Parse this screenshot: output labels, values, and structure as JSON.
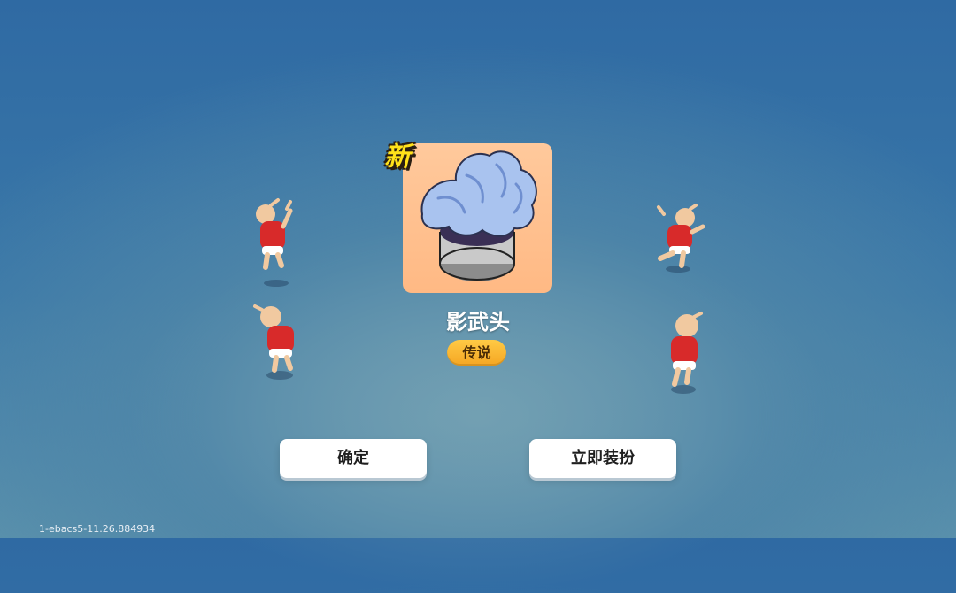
{
  "reward": {
    "badge": "新",
    "item_name": "影武头",
    "rarity": "传说",
    "icon": "spiky-blue-hair-helmet-icon"
  },
  "buttons": {
    "confirm": "确定",
    "equip_now": "立即装扮"
  },
  "footer": {
    "version": "1-ebacs5-11.26.884934"
  },
  "colors": {
    "card_bg": "#ffbf8a",
    "rarity_bg": "#f5a623",
    "badge": "#ffe21a"
  }
}
